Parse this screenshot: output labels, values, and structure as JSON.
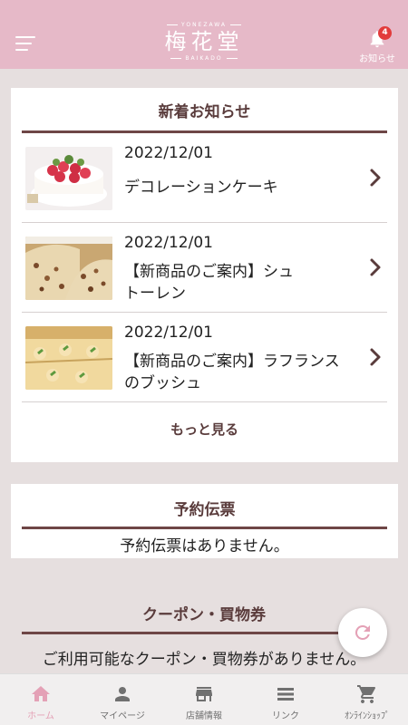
{
  "header": {
    "logo_top": "YONEZAWA",
    "logo_main": "梅花堂",
    "logo_bottom": "BAIKADO",
    "notice_label": "お知らせ",
    "notice_count": "4"
  },
  "news": {
    "title": "新着お知らせ",
    "items": [
      {
        "date": "2022/12/01",
        "text": "デコレーションケーキ",
        "image": "strawberry-cake"
      },
      {
        "date": "2022/12/01",
        "text": "【新商品のご案内】シュトーレン",
        "image": "stollen"
      },
      {
        "date": "2022/12/01",
        "text": "【新商品のご案内】ラフランスのブッシュ",
        "image": "la-france-bouche"
      }
    ],
    "more_label": "もっと見る"
  },
  "reservation": {
    "title": "予約伝票",
    "empty_text": "予約伝票はありません。"
  },
  "coupon": {
    "title": "クーポン・買物券",
    "empty_text": "ご利用可能なクーポン・買物券がありません。"
  },
  "fab": {
    "icon": "refresh-icon"
  },
  "tabs": [
    {
      "label": "ホーム",
      "icon": "home-icon",
      "active": true
    },
    {
      "label": "マイページ",
      "icon": "person-icon",
      "active": false
    },
    {
      "label": "店舗情報",
      "icon": "store-icon",
      "active": false
    },
    {
      "label": "リンク",
      "icon": "list-icon",
      "active": false
    },
    {
      "label": "ｵﾝﾗｲﾝｼｮｯﾌﾟ",
      "icon": "cart-icon",
      "active": false
    }
  ],
  "colors": {
    "header_bg": "#e6b9c8",
    "accent_brown": "#6e4646",
    "tab_active": "#e4a1b6",
    "badge": "#e23b3b"
  }
}
